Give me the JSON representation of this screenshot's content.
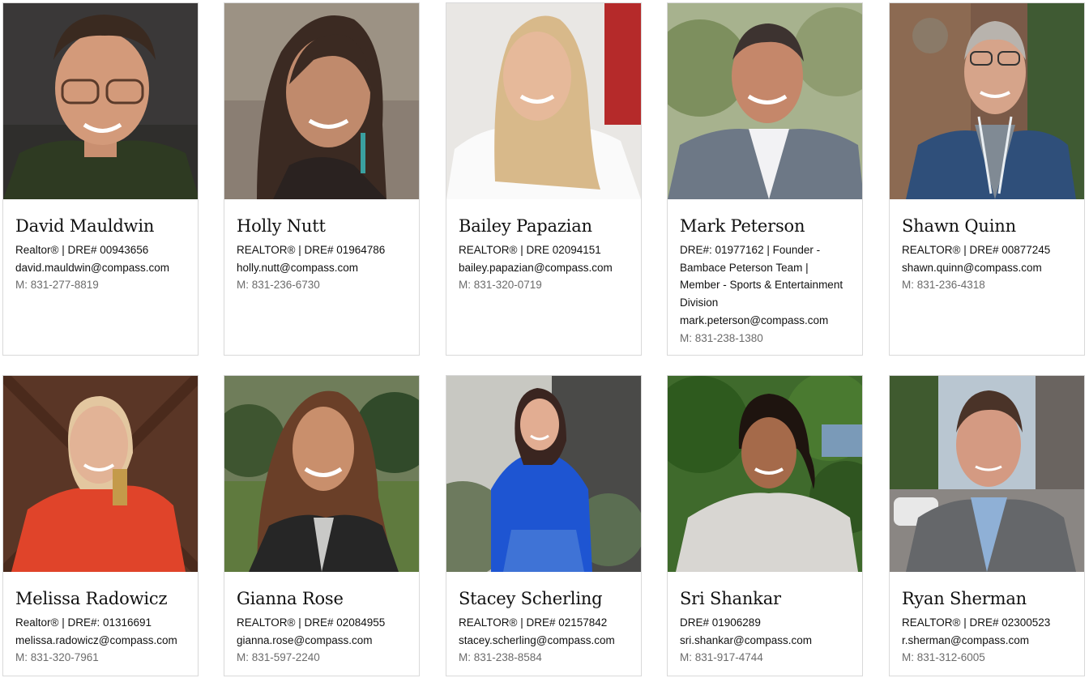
{
  "agents": [
    {
      "name": "David Mauldwin",
      "license": "Realtor® | DRE# 00943656",
      "email": "david.mauldwin@compass.com",
      "phone": "M: 831-277-8819"
    },
    {
      "name": "Holly Nutt",
      "license": "REALTOR® | DRE# 01964786",
      "email": "holly.nutt@compass.com",
      "phone": "M: 831-236-6730"
    },
    {
      "name": "Bailey Papazian",
      "license": "REALTOR® | DRE 02094151",
      "email": "bailey.papazian@compass.com",
      "phone": "M: 831-320-0719"
    },
    {
      "name": "Mark Peterson",
      "license": "DRE#: 01977162 | Founder - Bambace Peterson Team | Member - Sports & Entertainment Division",
      "email": "mark.peterson@compass.com",
      "phone": "M: 831-238-1380"
    },
    {
      "name": "Shawn Quinn",
      "license": "REALTOR® | DRE# 00877245",
      "email": "shawn.quinn@compass.com",
      "phone": "M: 831-236-4318"
    },
    {
      "name": "Melissa Radowicz",
      "license": "Realtor® | DRE#: 01316691",
      "email": "melissa.radowicz@compass.com",
      "phone": "M: 831-320-7961"
    },
    {
      "name": "Gianna Rose",
      "license": "REALTOR® | DRE# 02084955",
      "email": "gianna.rose@compass.com",
      "phone": "M: 831-597-2240"
    },
    {
      "name": "Stacey Scherling",
      "license": "REALTOR® | DRE# 02157842",
      "email": "stacey.scherling@compass.com",
      "phone": "M: 831-238-8584"
    },
    {
      "name": "Sri Shankar",
      "license": "DRE# 01906289",
      "email": "sri.shankar@compass.com",
      "phone": "M: 831-917-4744"
    },
    {
      "name": "Ryan Sherman",
      "license": "REALTOR® | DRE# 02300523",
      "email": "r.sherman@compass.com",
      "phone": "M: 831-312-6005"
    }
  ]
}
